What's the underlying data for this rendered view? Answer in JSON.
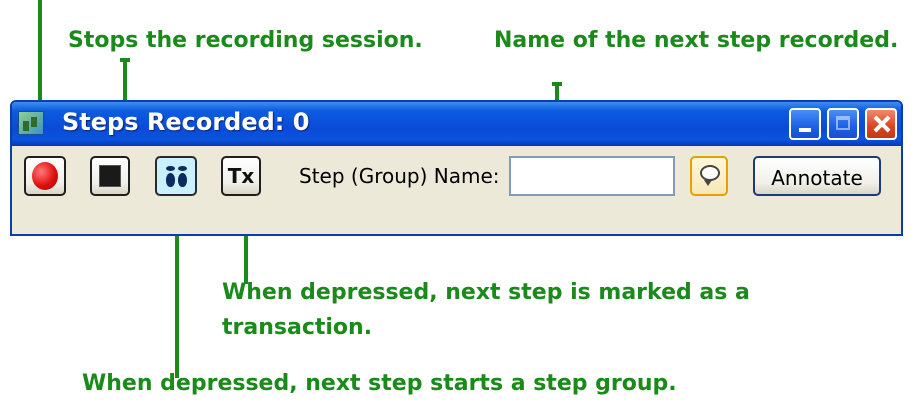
{
  "annotations": {
    "stop": "Stops the recording session.",
    "step_name": "Name of the next step recorded.",
    "transaction_line1": "When depressed, next step is marked as a",
    "transaction_line2": "transaction.",
    "step_group": "When depressed, next step starts a step group."
  },
  "window": {
    "title": "Steps Recorded: 0",
    "controls": [
      "minimize",
      "maximize",
      "close"
    ]
  },
  "toolbar": {
    "record_icon": "record-icon",
    "stop_icon": "stop-icon",
    "step_group_icon": "footsteps-icon",
    "tx_label": "Tx",
    "step_name_label": "Step (Group) Name:",
    "step_name_value": "",
    "comment_icon": "speech-bubble-icon",
    "annotate_label": "Annotate"
  },
  "colors": {
    "annotation_green": "#1a8a1a",
    "titlebar_blue": "#0a4ad8",
    "close_red": "#d9451f",
    "window_bg": "#ece9d8",
    "pressed_bg": "#c9f0ff"
  }
}
